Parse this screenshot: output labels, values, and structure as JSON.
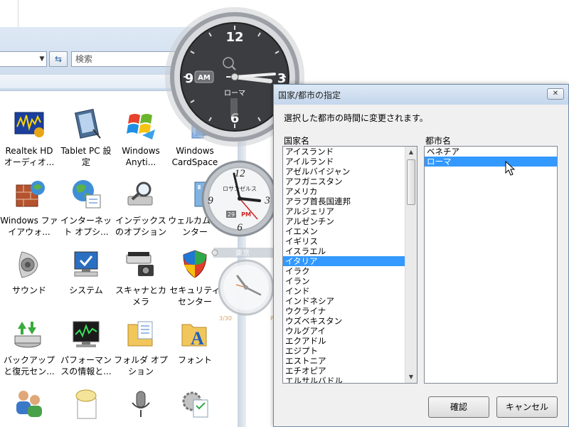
{
  "search": {
    "placeholder": "検索"
  },
  "control_panel": {
    "items": [
      {
        "label": "Realtek HD オーディオ...",
        "icon": "realtek-audio-icon"
      },
      {
        "label": "Tablet PC 設定",
        "icon": "tablet-pc-icon"
      },
      {
        "label": "Windows Anyti...",
        "icon": "windows-anytime-icon"
      },
      {
        "label": "Windows CardSpace",
        "icon": "cardspace-icon"
      },
      {
        "label": "Windows ファイアウォ...",
        "icon": "firewall-icon"
      },
      {
        "label": "インターネット オプシ...",
        "icon": "internet-options-icon"
      },
      {
        "label": "インデックスのオプション",
        "icon": "indexing-icon"
      },
      {
        "label": "ウェルカム センター",
        "icon": "welcome-center-icon"
      },
      {
        "label": "サウンド",
        "icon": "sound-icon"
      },
      {
        "label": "システム",
        "icon": "system-icon"
      },
      {
        "label": "スキャナとカメラ",
        "icon": "scanner-camera-icon"
      },
      {
        "label": "セキュリティ センター",
        "icon": "security-center-icon"
      },
      {
        "label": "バックアップと復元セン...",
        "icon": "backup-icon"
      },
      {
        "label": "パフォーマンスの情報と...",
        "icon": "performance-icon"
      },
      {
        "label": "フォルダ オプション",
        "icon": "folder-options-icon"
      },
      {
        "label": "フォント",
        "icon": "font-icon"
      },
      {
        "label": "",
        "icon": "users-icon"
      },
      {
        "label": "",
        "icon": "speech-icon"
      },
      {
        "label": "",
        "icon": "microphone-icon"
      },
      {
        "label": "",
        "icon": "programs-icon"
      }
    ]
  },
  "clocks": {
    "big": {
      "n12": "12",
      "n3": "3",
      "n6": "6",
      "n9": "9",
      "ampm": "AM",
      "city": "ローマ"
    },
    "medium": {
      "n12": "12",
      "n3": "3",
      "n6": "6",
      "n9": "9",
      "city": "ロサンゼルス",
      "date": "29",
      "ampm": "PM"
    },
    "small": {
      "city": "東京",
      "date": "3/30",
      "ampm": "PM"
    }
  },
  "dialog": {
    "title": "国家/都市の指定",
    "description": "選択した都市の時間に変更されます。",
    "country_label": "国家名",
    "city_label": "都市名",
    "countries": [
      "アイスランド",
      "アイルランド",
      "アゼルバイジャン",
      "アフガニスタン",
      "アメリカ",
      "アラブ首長国連邦",
      "アルジェリア",
      "アルゼンチン",
      "イエメン",
      "イギリス",
      "イスラエル",
      "イタリア",
      "イラク",
      "イラン",
      "インド",
      "インドネシア",
      "ウクライナ",
      "ウズベキスタン",
      "ウルグアイ",
      "エクアドル",
      "エジプト",
      "エストニア",
      "エチオピア",
      "エルサルバドル"
    ],
    "selected_country": "イタリア",
    "cities": [
      "ベネチア",
      "ローマ"
    ],
    "selected_city": "ローマ",
    "ok_label": "確認",
    "cancel_label": "キャンセル",
    "close_glyph": "✕"
  }
}
